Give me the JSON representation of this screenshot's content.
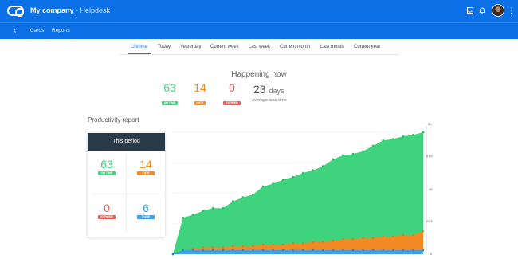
{
  "header": {
    "company": "My company",
    "separator": " - ",
    "app": "Helpdesk"
  },
  "subnav": {
    "back": "‹",
    "items": [
      "Cards",
      "Reports"
    ]
  },
  "tabs": [
    "Lifetime",
    "Today",
    "Yesterday",
    "Current week",
    "Last week",
    "Current month",
    "Last month",
    "Current year"
  ],
  "active_tab": "Lifetime",
  "happening": {
    "title": "Happening now",
    "on_time": {
      "value": "63",
      "label": "ON TIME"
    },
    "late": {
      "value": "14",
      "label": "LATE"
    },
    "expired": {
      "value": "0",
      "label": "EXPIRED"
    },
    "lead_time_value": "23",
    "lead_time_unit": "days",
    "lead_time_label": "average lead time"
  },
  "productivity": {
    "title": "Productivity report",
    "panel_title": "This period",
    "on_time": {
      "value": "63",
      "label": "ON TIME"
    },
    "late": {
      "value": "14",
      "label": "LATE"
    },
    "expired": {
      "value": "0",
      "label": "EXPIRED"
    },
    "done": {
      "value": "6",
      "label": "DONE"
    }
  },
  "colors": {
    "primary": "#0b6fe6",
    "green": "#3ed37c",
    "orange": "#f48a23",
    "red": "#ea5b55",
    "blue": "#3aa0e8",
    "panel_header": "#2a3a46"
  },
  "chart_data": {
    "type": "area",
    "y_ticks": [
      "0",
      "22.5",
      "45",
      "67.5",
      "90"
    ],
    "ylim": [
      0,
      90
    ],
    "series": [
      {
        "color": "#3ed37c",
        "values": [
          0,
          27,
          29,
          32,
          34,
          34,
          39,
          42,
          44,
          50,
          52,
          55,
          57,
          60,
          62,
          65,
          70,
          73,
          74,
          76,
          80,
          84,
          85,
          87,
          88,
          90
        ]
      },
      {
        "color": "#f48a23",
        "values": [
          0,
          3,
          4,
          5,
          5,
          5,
          6,
          6,
          6,
          7,
          7,
          7,
          8,
          8,
          9,
          9,
          10,
          11,
          11,
          12,
          12,
          13,
          13,
          14,
          14,
          17
        ]
      },
      {
        "color": "#3aa0e8",
        "values": [
          0,
          3,
          3,
          3,
          3,
          3,
          3,
          3,
          3,
          3,
          3,
          3,
          3,
          3,
          3,
          3,
          3,
          3,
          3,
          3,
          3,
          3,
          3,
          3,
          3,
          3
        ]
      }
    ]
  }
}
